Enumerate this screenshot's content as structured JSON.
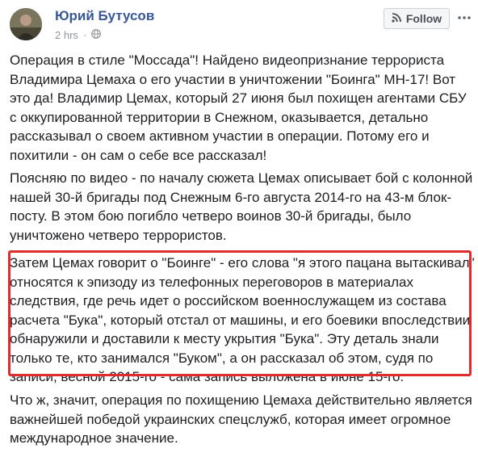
{
  "post": {
    "author": "Юрий Бутусов",
    "time": "2 hrs",
    "dot": "·",
    "audience_icon": "globe-icon",
    "follow_label": "Follow",
    "more_icon": "more-dots-icon",
    "colors": {
      "author": "#385898",
      "highlight_border": "#e02c2c",
      "text": "#1c1e21",
      "meta": "#90949c"
    }
  },
  "paragraphs": [
    {
      "lines": [
        "Операция в стиле \"Моссада\"! Найдено видеопризнание террориста",
        "Владимира Цемаха о его участии в уничтожении \"Боинга\" МН-17! Вот",
        "это да! Владимир Цемах, который 27 июня был похищен агентами СБУ",
        "с оккупированной территории в Снежном, оказывается, детально",
        "рассказывал о своем активном участии в операции. Потому его и",
        "похитили - он сам о себе все рассказал!"
      ]
    },
    {
      "lines": [
        "Поясняю по видео - по началу сюжета Цемах описывает бой с колонной",
        "нашей 30-й бригады под Снежным 6-го августа 2014-го на 43-м блок-",
        "посту. В этом бою погибло четверо воинов 30-й бригады, было",
        "уничтожено четверо террористов."
      ]
    },
    {
      "lines": [
        "Затем Цемах говорит о \"Боинге\" - его слова \"я этого пацана вытаскивал\"",
        "относятся к эпизоду из телефонных переговоров в материалах",
        "следствия, где речь идет о российском военнослужащем из состава",
        "расчета \"Бука\", который отстал от машины, и его боевики впоследствии",
        "обнаружили и доставили к месту укрытия \"Бука\". Эту деталь знали",
        "только те, кто занимался \"Буком\", а он рассказал об этом, судя по",
        "записи, весной 2015-го - сама запись выложена в июне 15-го."
      ]
    },
    {
      "lines": [
        "Что ж, значит, операция по похищению Цемаха действительно является",
        "важнейшей победой украинских спецслужб, которая имеет огромное",
        "международное значение."
      ]
    }
  ]
}
